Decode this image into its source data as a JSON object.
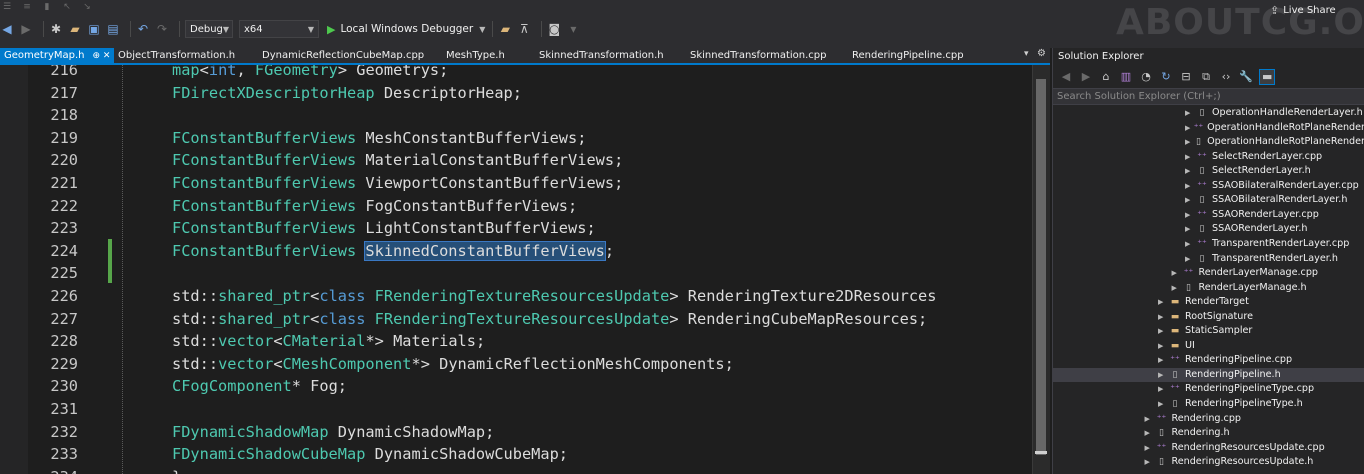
{
  "toolbar": {
    "config": "Debug",
    "platform": "x64",
    "debugger": "Local Windows Debugger",
    "live_share": "Live Share",
    "watermark": "ABOUTCG.OR"
  },
  "tabs": [
    {
      "label": "GeometryMap.h",
      "pin": "⊕ ✕",
      "active": true
    },
    {
      "label": "ObjectTransformation.h"
    },
    {
      "label": "DynamicReflectionCubeMap.cpp"
    },
    {
      "label": "MeshType.h"
    },
    {
      "label": "SkinnedTransformation.h"
    },
    {
      "label": "SkinnedTransformation.cpp"
    },
    {
      "label": "RenderingPipeline.cpp"
    }
  ],
  "editor": {
    "lines": [
      {
        "n": "216",
        "text": "map<int, FGeometry> Geometrys;"
      },
      {
        "n": "217",
        "text": "FDirectXDescriptorHeap DescriptorHeap;"
      },
      {
        "n": "218",
        "text": ""
      },
      {
        "n": "219",
        "text": "FConstantBufferViews MeshConstantBufferViews;"
      },
      {
        "n": "220",
        "text": "FConstantBufferViews MaterialConstantBufferViews;"
      },
      {
        "n": "221",
        "text": "FConstantBufferViews ViewportConstantBufferViews;"
      },
      {
        "n": "222",
        "text": "FConstantBufferViews FogConstantBufferViews;"
      },
      {
        "n": "223",
        "text": "FConstantBufferViews LightConstantBufferViews;"
      },
      {
        "n": "224",
        "text": "FConstantBufferViews SkinnedConstantBufferViews;"
      },
      {
        "n": "225",
        "text": ""
      },
      {
        "n": "226",
        "text": "std::shared_ptr<class FRenderingTextureResourcesUpdate> RenderingTexture2DResources"
      },
      {
        "n": "227",
        "text": "std::shared_ptr<class FRenderingTextureResourcesUpdate> RenderingCubeMapResources;"
      },
      {
        "n": "228",
        "text": "std::vector<CMaterial*> Materials;"
      },
      {
        "n": "229",
        "text": "std::vector<CMeshComponent*> DynamicReflectionMeshComponents;"
      },
      {
        "n": "230",
        "text": "CFogComponent* Fog;"
      },
      {
        "n": "231",
        "text": ""
      },
      {
        "n": "232",
        "text": "FDynamicShadowMap DynamicShadowMap;"
      },
      {
        "n": "233",
        "text": "FDynamicShadowCubeMap DynamicShadowCubeMap;"
      },
      {
        "n": "234",
        "text": "};"
      }
    ],
    "selected_text": "SkinnedConstantBufferViews"
  },
  "solution_explorer": {
    "title": "Solution Explorer",
    "search_placeholder": "Search Solution Explorer (Ctrl+;)",
    "items": [
      {
        "label": "OperationHandleRenderLayer.h",
        "kind": "h",
        "level": 5
      },
      {
        "label": "OperationHandleRotPlaneRender",
        "kind": "cpp",
        "level": 5
      },
      {
        "label": "OperationHandleRotPlaneRender",
        "kind": "h",
        "level": 5
      },
      {
        "label": "SelectRenderLayer.cpp",
        "kind": "cpp",
        "level": 5
      },
      {
        "label": "SelectRenderLayer.h",
        "kind": "h",
        "level": 5
      },
      {
        "label": "SSAOBilateralRenderLayer.cpp",
        "kind": "cpp",
        "level": 5
      },
      {
        "label": "SSAOBilateralRenderLayer.h",
        "kind": "h",
        "level": 5
      },
      {
        "label": "SSAORenderLayer.cpp",
        "kind": "cpp",
        "level": 5
      },
      {
        "label": "SSAORenderLayer.h",
        "kind": "h",
        "level": 5
      },
      {
        "label": "TransparentRenderLayer.cpp",
        "kind": "cpp",
        "level": 5
      },
      {
        "label": "TransparentRenderLayer.h",
        "kind": "h",
        "level": 5
      },
      {
        "label": "RenderLayerManage.cpp",
        "kind": "cpp",
        "level": 4
      },
      {
        "label": "RenderLayerManage.h",
        "kind": "h",
        "level": 4
      },
      {
        "label": "RenderTarget",
        "kind": "folder",
        "level": 3
      },
      {
        "label": "RootSignature",
        "kind": "folder",
        "level": 3
      },
      {
        "label": "StaticSampler",
        "kind": "folder",
        "level": 3
      },
      {
        "label": "UI",
        "kind": "folder",
        "level": 3
      },
      {
        "label": "RenderingPipeline.cpp",
        "kind": "cpp",
        "level": 3
      },
      {
        "label": "RenderingPipeline.h",
        "kind": "h",
        "level": 3,
        "selected": true
      },
      {
        "label": "RenderingPipelineType.cpp",
        "kind": "cpp",
        "level": 3
      },
      {
        "label": "RenderingPipelineType.h",
        "kind": "h",
        "level": 3
      },
      {
        "label": "Rendering.cpp",
        "kind": "cpp",
        "level": 2
      },
      {
        "label": "Rendering.h",
        "kind": "h",
        "level": 2
      },
      {
        "label": "RenderingResourcesUpdate.cpp",
        "kind": "cpp",
        "level": 2
      },
      {
        "label": "RenderingResourcesUpdate.h",
        "kind": "h",
        "level": 2
      }
    ]
  }
}
